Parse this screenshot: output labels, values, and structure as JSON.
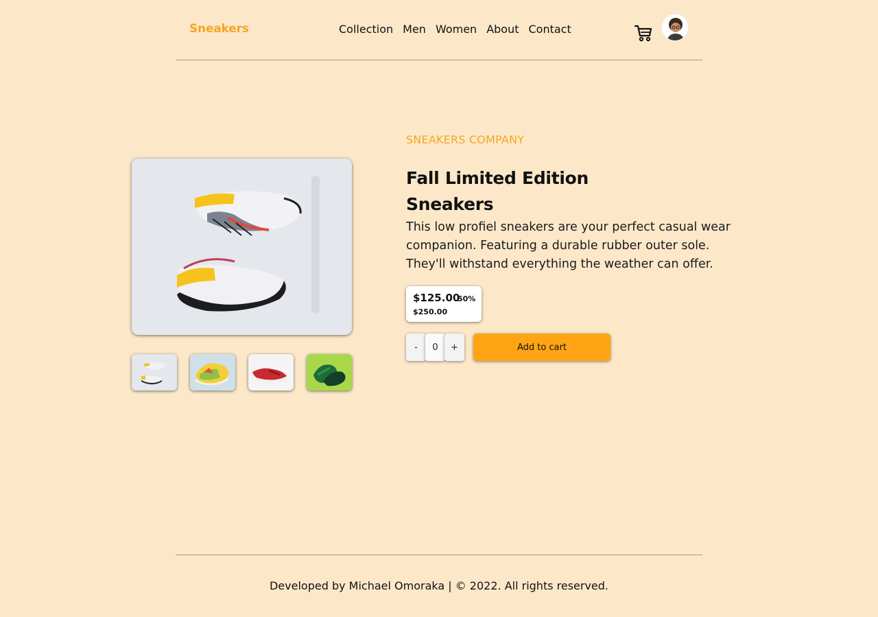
{
  "header": {
    "logo": "Sneakers",
    "nav": [
      "Collection",
      "Men",
      "Women",
      "About",
      "Contact"
    ]
  },
  "icons": {
    "cart": "cart-icon",
    "avatar": "avatar"
  },
  "product": {
    "company": "SNEAKERS COMPANY",
    "title_line1": "Fall Limited Edition",
    "title_line2": "Sneakers",
    "description": "This low profiel sneakers are your perfect casual wear companion. Featuring a durable rubber outer sole. They'll withstand everything the weather can offer.",
    "price": "$125.00",
    "discount": "50%",
    "original_price": "$250.00",
    "quantity": "0",
    "decrement": "-",
    "increment": "+",
    "add_to_cart": "Add to cart"
  },
  "footer": {
    "text": "Developed by Michael Omoraka | © 2022. All rights reserved."
  },
  "colors": {
    "background": "#fce8c9",
    "accent": "#f5a623",
    "button": "#ffa514"
  }
}
